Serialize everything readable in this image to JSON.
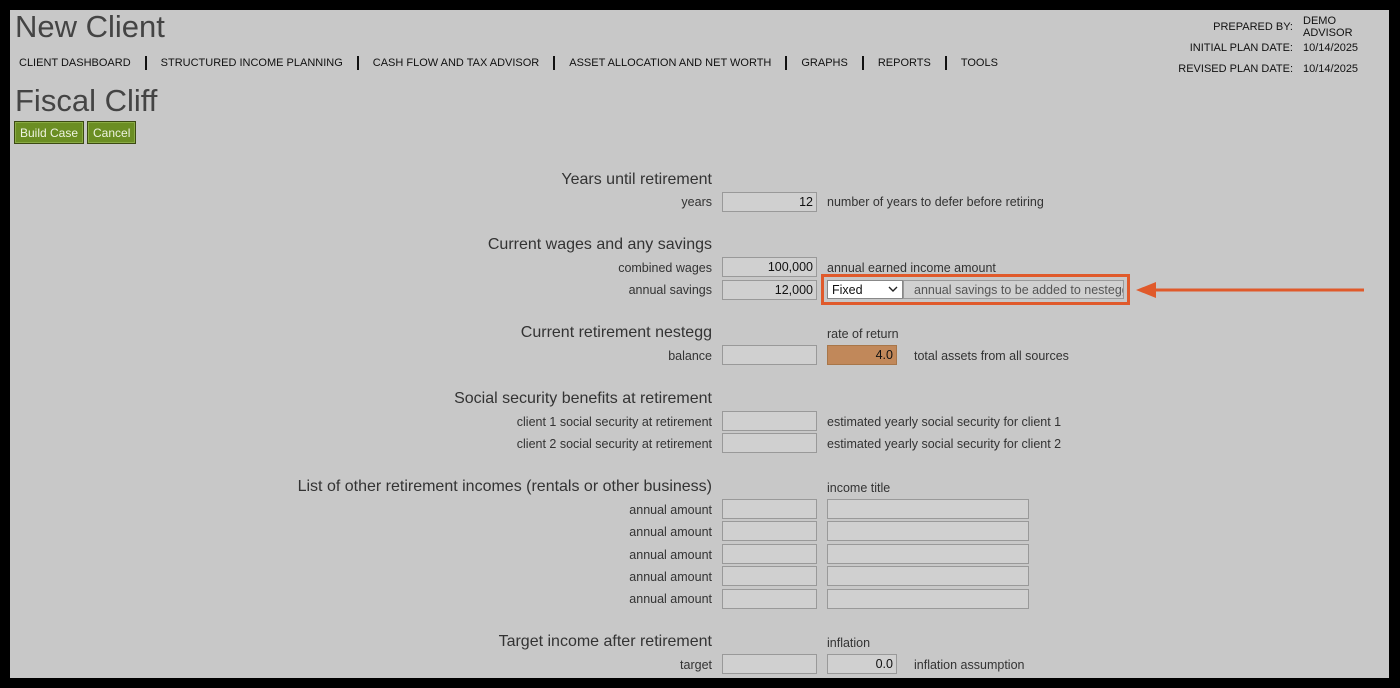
{
  "client_name": "New Client",
  "info": {
    "prepared_by_label": "PREPARED BY:",
    "prepared_by_value": "DEMO ADVISOR",
    "initial_label": "INITIAL PLAN DATE:",
    "initial_value": "10/14/2025",
    "revised_label": "REVISED PLAN DATE:",
    "revised_value": "10/14/2025"
  },
  "nav": [
    "CLIENT DASHBOARD",
    "STRUCTURED INCOME PLANNING",
    "CASH FLOW AND TAX ADVISOR",
    "ASSET ALLOCATION AND NET WORTH",
    "GRAPHS",
    "REPORTS",
    "TOOLS"
  ],
  "page_title": "Fiscal Cliff",
  "buttons": {
    "build": "Build Case",
    "cancel": "Cancel"
  },
  "years": {
    "title": "Years until retirement",
    "label": "years",
    "value": "12",
    "desc": "number of years to defer before retiring"
  },
  "wages": {
    "title": "Current wages and any savings",
    "combined_label": "combined wages",
    "combined_value": "100,000",
    "combined_desc": "annual earned income amount",
    "savings_label": "annual savings",
    "savings_value": "12,000",
    "savings_type": "Fixed",
    "savings_desc": "annual savings to be added to nestegg"
  },
  "nestegg": {
    "title": "Current retirement nestegg",
    "rate_header": "rate of return",
    "balance_label": "balance",
    "balance_value": "",
    "rate_value": "4.0",
    "desc": "total assets from all sources"
  },
  "social": {
    "title": "Social security benefits at retirement",
    "c1_label": "client 1 social security at retirement",
    "c1_value": "",
    "c1_desc": "estimated yearly social security for client 1",
    "c2_label": "client 2 social security at retirement",
    "c2_value": "",
    "c2_desc": "estimated yearly social security for client 2"
  },
  "other": {
    "title": "List of other retirement incomes (rentals or other business)",
    "income_title_header": "income title",
    "rows": [
      {
        "label": "annual amount",
        "amount": "",
        "title": ""
      },
      {
        "label": "annual amount",
        "amount": "",
        "title": ""
      },
      {
        "label": "annual amount",
        "amount": "",
        "title": ""
      },
      {
        "label": "annual amount",
        "amount": "",
        "title": ""
      },
      {
        "label": "annual amount",
        "amount": "",
        "title": ""
      }
    ]
  },
  "target": {
    "title": "Target income after retirement",
    "inflation_header": "inflation",
    "label": "target",
    "value": "",
    "inflation_value": "0.0",
    "desc": "inflation assumption"
  },
  "colors": {
    "button": "#6b8e23",
    "rate_field": "#c1885a",
    "highlight": "#e05a2b"
  },
  "icons": {
    "select_caret": "chevron-down-icon",
    "callout": "arrow-left-icon"
  }
}
